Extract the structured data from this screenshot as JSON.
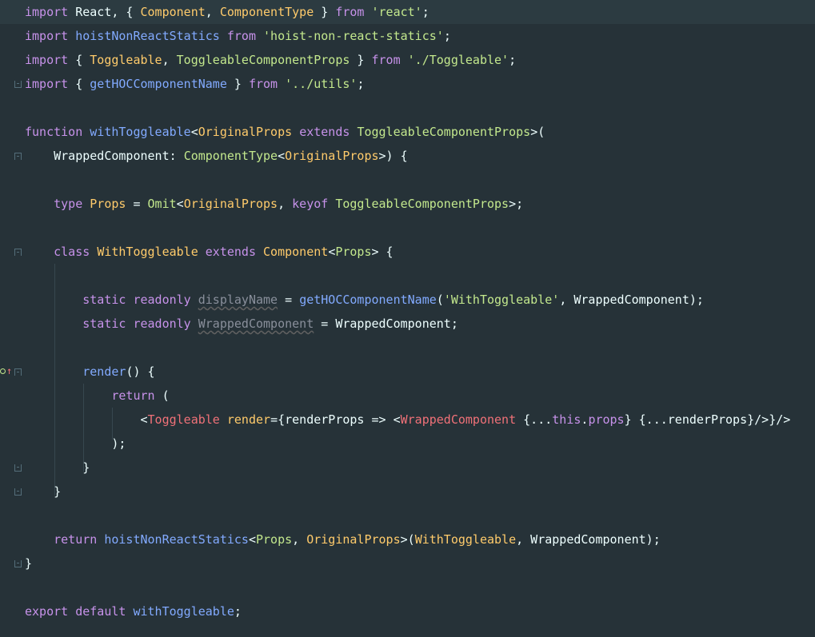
{
  "colors": {
    "background": "#263238",
    "current_line": "#2c3b41",
    "keyword": "#c792ea",
    "string": "#c3e88d",
    "function": "#82aaff",
    "type": "#ffcb6b",
    "plain": "#eeffff",
    "punctuation": "#89ddff",
    "tag": "#f07178",
    "comment_gray": "#898f9b"
  },
  "lines": [
    {
      "tokens": [
        {
          "t": "import",
          "c": "keyword"
        },
        {
          "t": " React, { ",
          "c": "plain"
        },
        {
          "t": "Component",
          "c": "type"
        },
        {
          "t": ", ",
          "c": "plain"
        },
        {
          "t": "ComponentType",
          "c": "type"
        },
        {
          "t": " } ",
          "c": "plain"
        },
        {
          "t": "from",
          "c": "keyword"
        },
        {
          "t": " ",
          "c": "plain"
        },
        {
          "t": "'react'",
          "c": "string"
        },
        {
          "t": ";",
          "c": "plain"
        }
      ]
    },
    {
      "tokens": [
        {
          "t": "import",
          "c": "keyword"
        },
        {
          "t": " ",
          "c": "plain"
        },
        {
          "t": "hoistNonReactStatics",
          "c": "function"
        },
        {
          "t": " ",
          "c": "plain"
        },
        {
          "t": "from",
          "c": "keyword"
        },
        {
          "t": " ",
          "c": "plain"
        },
        {
          "t": "'hoist-non-react-statics'",
          "c": "string"
        },
        {
          "t": ";",
          "c": "plain"
        }
      ]
    },
    {
      "tokens": [
        {
          "t": "import",
          "c": "keyword"
        },
        {
          "t": " { ",
          "c": "plain"
        },
        {
          "t": "Toggleable",
          "c": "type"
        },
        {
          "t": ", ",
          "c": "plain"
        },
        {
          "t": "ToggleableComponentProps",
          "c": "string"
        },
        {
          "t": " } ",
          "c": "plain"
        },
        {
          "t": "from",
          "c": "keyword"
        },
        {
          "t": " ",
          "c": "plain"
        },
        {
          "t": "'./Toggleable'",
          "c": "string"
        },
        {
          "t": ";",
          "c": "plain"
        }
      ]
    },
    {
      "tokens": [
        {
          "t": "import",
          "c": "keyword"
        },
        {
          "t": " { ",
          "c": "plain"
        },
        {
          "t": "getHOCComponentName",
          "c": "function"
        },
        {
          "t": " } ",
          "c": "plain"
        },
        {
          "t": "from",
          "c": "keyword"
        },
        {
          "t": " ",
          "c": "plain"
        },
        {
          "t": "'../utils'",
          "c": "string"
        },
        {
          "t": ";",
          "c": "plain"
        }
      ]
    },
    {
      "tokens": []
    },
    {
      "tokens": [
        {
          "t": "function",
          "c": "keyword"
        },
        {
          "t": " ",
          "c": "plain"
        },
        {
          "t": "withToggleable",
          "c": "function"
        },
        {
          "t": "<",
          "c": "plain"
        },
        {
          "t": "OriginalProps",
          "c": "type"
        },
        {
          "t": " ",
          "c": "plain"
        },
        {
          "t": "extends",
          "c": "keyword"
        },
        {
          "t": " ",
          "c": "plain"
        },
        {
          "t": "ToggleableComponentProps",
          "c": "string"
        },
        {
          "t": ">(",
          "c": "plain"
        }
      ]
    },
    {
      "tokens": [
        {
          "t": "    WrappedComponent: ",
          "c": "plain"
        },
        {
          "t": "ComponentType",
          "c": "string"
        },
        {
          "t": "<",
          "c": "plain"
        },
        {
          "t": "OriginalProps",
          "c": "type"
        },
        {
          "t": ">) {",
          "c": "plain"
        }
      ]
    },
    {
      "tokens": []
    },
    {
      "tokens": [
        {
          "t": "    ",
          "c": "plain"
        },
        {
          "t": "type",
          "c": "keyword"
        },
        {
          "t": " ",
          "c": "plain"
        },
        {
          "t": "Props",
          "c": "type"
        },
        {
          "t": " = ",
          "c": "plain"
        },
        {
          "t": "Omit",
          "c": "string"
        },
        {
          "t": "<",
          "c": "plain"
        },
        {
          "t": "OriginalProps",
          "c": "type"
        },
        {
          "t": ", ",
          "c": "plain"
        },
        {
          "t": "keyof",
          "c": "keyword"
        },
        {
          "t": " ",
          "c": "plain"
        },
        {
          "t": "ToggleableComponentProps",
          "c": "string"
        },
        {
          "t": ">;",
          "c": "plain"
        }
      ]
    },
    {
      "tokens": []
    },
    {
      "tokens": [
        {
          "t": "    ",
          "c": "plain"
        },
        {
          "t": "class",
          "c": "keyword"
        },
        {
          "t": " ",
          "c": "plain"
        },
        {
          "t": "WithToggleable",
          "c": "type"
        },
        {
          "t": " ",
          "c": "plain"
        },
        {
          "t": "extends",
          "c": "keyword"
        },
        {
          "t": " ",
          "c": "plain"
        },
        {
          "t": "Component",
          "c": "type"
        },
        {
          "t": "<",
          "c": "plain"
        },
        {
          "t": "Props",
          "c": "string"
        },
        {
          "t": "> {",
          "c": "plain"
        }
      ]
    },
    {
      "tokens": []
    },
    {
      "tokens": [
        {
          "t": "        ",
          "c": "plain"
        },
        {
          "t": "static",
          "c": "keyword"
        },
        {
          "t": " ",
          "c": "plain"
        },
        {
          "t": "readonly",
          "c": "keyword"
        },
        {
          "t": " ",
          "c": "plain"
        },
        {
          "t": "displayName",
          "c": "comment_gray",
          "u": true
        },
        {
          "t": " = ",
          "c": "plain"
        },
        {
          "t": "getHOCComponentName",
          "c": "function"
        },
        {
          "t": "(",
          "c": "plain"
        },
        {
          "t": "'WithToggleable'",
          "c": "string"
        },
        {
          "t": ", WrappedComponent);",
          "c": "plain"
        }
      ]
    },
    {
      "tokens": [
        {
          "t": "        ",
          "c": "plain"
        },
        {
          "t": "static",
          "c": "keyword"
        },
        {
          "t": " ",
          "c": "plain"
        },
        {
          "t": "readonly",
          "c": "keyword"
        },
        {
          "t": " ",
          "c": "plain"
        },
        {
          "t": "WrappedComponent",
          "c": "comment_gray",
          "u": true
        },
        {
          "t": " = WrappedComponent;",
          "c": "plain"
        }
      ]
    },
    {
      "tokens": []
    },
    {
      "tokens": [
        {
          "t": "        ",
          "c": "plain"
        },
        {
          "t": "render",
          "c": "function"
        },
        {
          "t": "() {",
          "c": "plain"
        }
      ]
    },
    {
      "tokens": [
        {
          "t": "            ",
          "c": "plain"
        },
        {
          "t": "return",
          "c": "keyword"
        },
        {
          "t": " (",
          "c": "plain"
        }
      ]
    },
    {
      "tokens": [
        {
          "t": "                ",
          "c": "plain"
        },
        {
          "t": "<",
          "c": "plain"
        },
        {
          "t": "Toggleable",
          "c": "tag"
        },
        {
          "t": " ",
          "c": "plain"
        },
        {
          "t": "render",
          "c": "type"
        },
        {
          "t": "={renderProps => <",
          "c": "plain"
        },
        {
          "t": "WrappedComponent",
          "c": "tag"
        },
        {
          "t": " {...",
          "c": "plain"
        },
        {
          "t": "this",
          "c": "keyword"
        },
        {
          "t": ".",
          "c": "plain"
        },
        {
          "t": "props",
          "c": "keyword"
        },
        {
          "t": "} {...renderProps}/>}/>",
          "c": "plain"
        }
      ]
    },
    {
      "tokens": [
        {
          "t": "            );",
          "c": "plain"
        }
      ]
    },
    {
      "tokens": [
        {
          "t": "        }",
          "c": "plain"
        }
      ]
    },
    {
      "tokens": [
        {
          "t": "    }",
          "c": "plain"
        }
      ]
    },
    {
      "tokens": []
    },
    {
      "tokens": [
        {
          "t": "    ",
          "c": "plain"
        },
        {
          "t": "return",
          "c": "keyword"
        },
        {
          "t": " ",
          "c": "plain"
        },
        {
          "t": "hoistNonReactStatics",
          "c": "function"
        },
        {
          "t": "<",
          "c": "plain"
        },
        {
          "t": "Props",
          "c": "string"
        },
        {
          "t": ", ",
          "c": "plain"
        },
        {
          "t": "OriginalProps",
          "c": "type"
        },
        {
          "t": ">(",
          "c": "plain"
        },
        {
          "t": "WithToggleable",
          "c": "type"
        },
        {
          "t": ", WrappedComponent);",
          "c": "plain"
        }
      ]
    },
    {
      "tokens": [
        {
          "t": "}",
          "c": "plain"
        }
      ]
    },
    {
      "tokens": []
    },
    {
      "tokens": [
        {
          "t": "export",
          "c": "keyword"
        },
        {
          "t": " ",
          "c": "plain"
        },
        {
          "t": "default",
          "c": "keyword"
        },
        {
          "t": " ",
          "c": "plain"
        },
        {
          "t": "withToggleable",
          "c": "function"
        },
        {
          "t": ";",
          "c": "plain"
        }
      ]
    }
  ]
}
